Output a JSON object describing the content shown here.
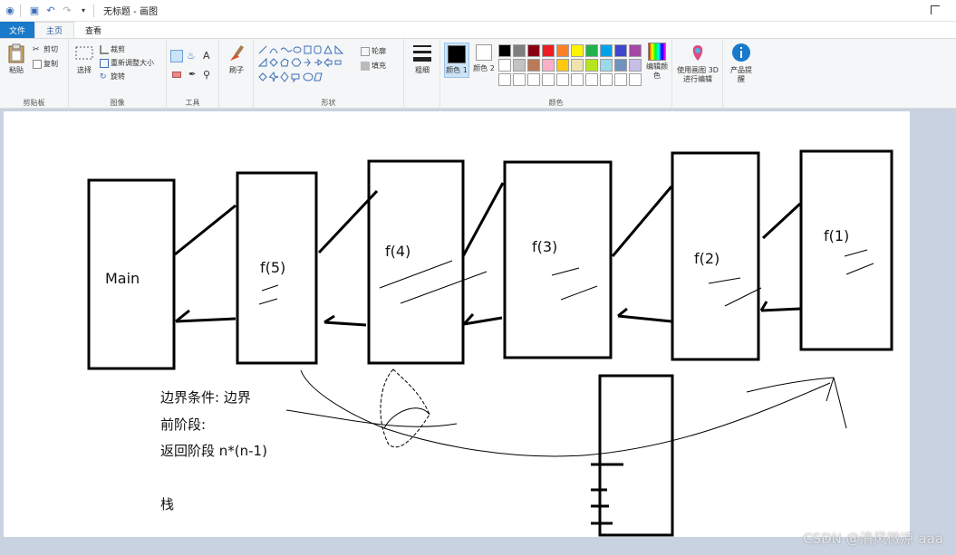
{
  "title": "无标题 - 画图",
  "tabs": [
    {
      "label": "文件"
    },
    {
      "label": "主页"
    },
    {
      "label": "查看"
    }
  ],
  "ribbon": {
    "clipboard": {
      "label": "剪贴板",
      "paste": "粘贴",
      "cut": "剪切",
      "copy": "复制"
    },
    "image": {
      "label": "图像",
      "select": "选择",
      "crop": "裁剪",
      "resize": "重新调整大小",
      "rotate": "旋转"
    },
    "tools": {
      "label": "工具"
    },
    "brushes": {
      "label": "刷子"
    },
    "shapes": {
      "label": "形状",
      "outline": "轮廓",
      "fill": "填充"
    },
    "size": {
      "label": "粗细"
    },
    "colors": {
      "label": "颜色",
      "color1": "颜色 1",
      "color2": "颜色 2",
      "edit": "编辑颜色",
      "paint3d": "使用画图 3D 进行编辑",
      "product_alert": "产品提醒",
      "palette": [
        "#000000",
        "#7f7f7f",
        "#880015",
        "#ed1c24",
        "#ff7f27",
        "#fff200",
        "#22b14c",
        "#00a2e8",
        "#3f48cc",
        "#a349a4",
        "#ffffff",
        "#c3c3c3",
        "#b97a57",
        "#ffaec9",
        "#ffc90e",
        "#efe4b0",
        "#b5e61d",
        "#99d9ea",
        "#7092be",
        "#c8bfe7",
        "#ffffff",
        "#ffffff",
        "#ffffff",
        "#ffffff",
        "#ffffff",
        "#ffffff",
        "#ffffff",
        "#ffffff",
        "#ffffff",
        "#ffffff"
      ]
    }
  },
  "canvas": {
    "boxes": [
      "Main",
      "f(5)",
      "f(4)",
      "f(3)",
      "f(2)",
      "f(1)"
    ],
    "notes": {
      "boundary": "边界条件: 边界",
      "forward": "前阶段:",
      "return": "返回阶段  n*(n-1)",
      "stack": "栈"
    }
  },
  "watermark": "CSDN @清风微凉 aaa"
}
